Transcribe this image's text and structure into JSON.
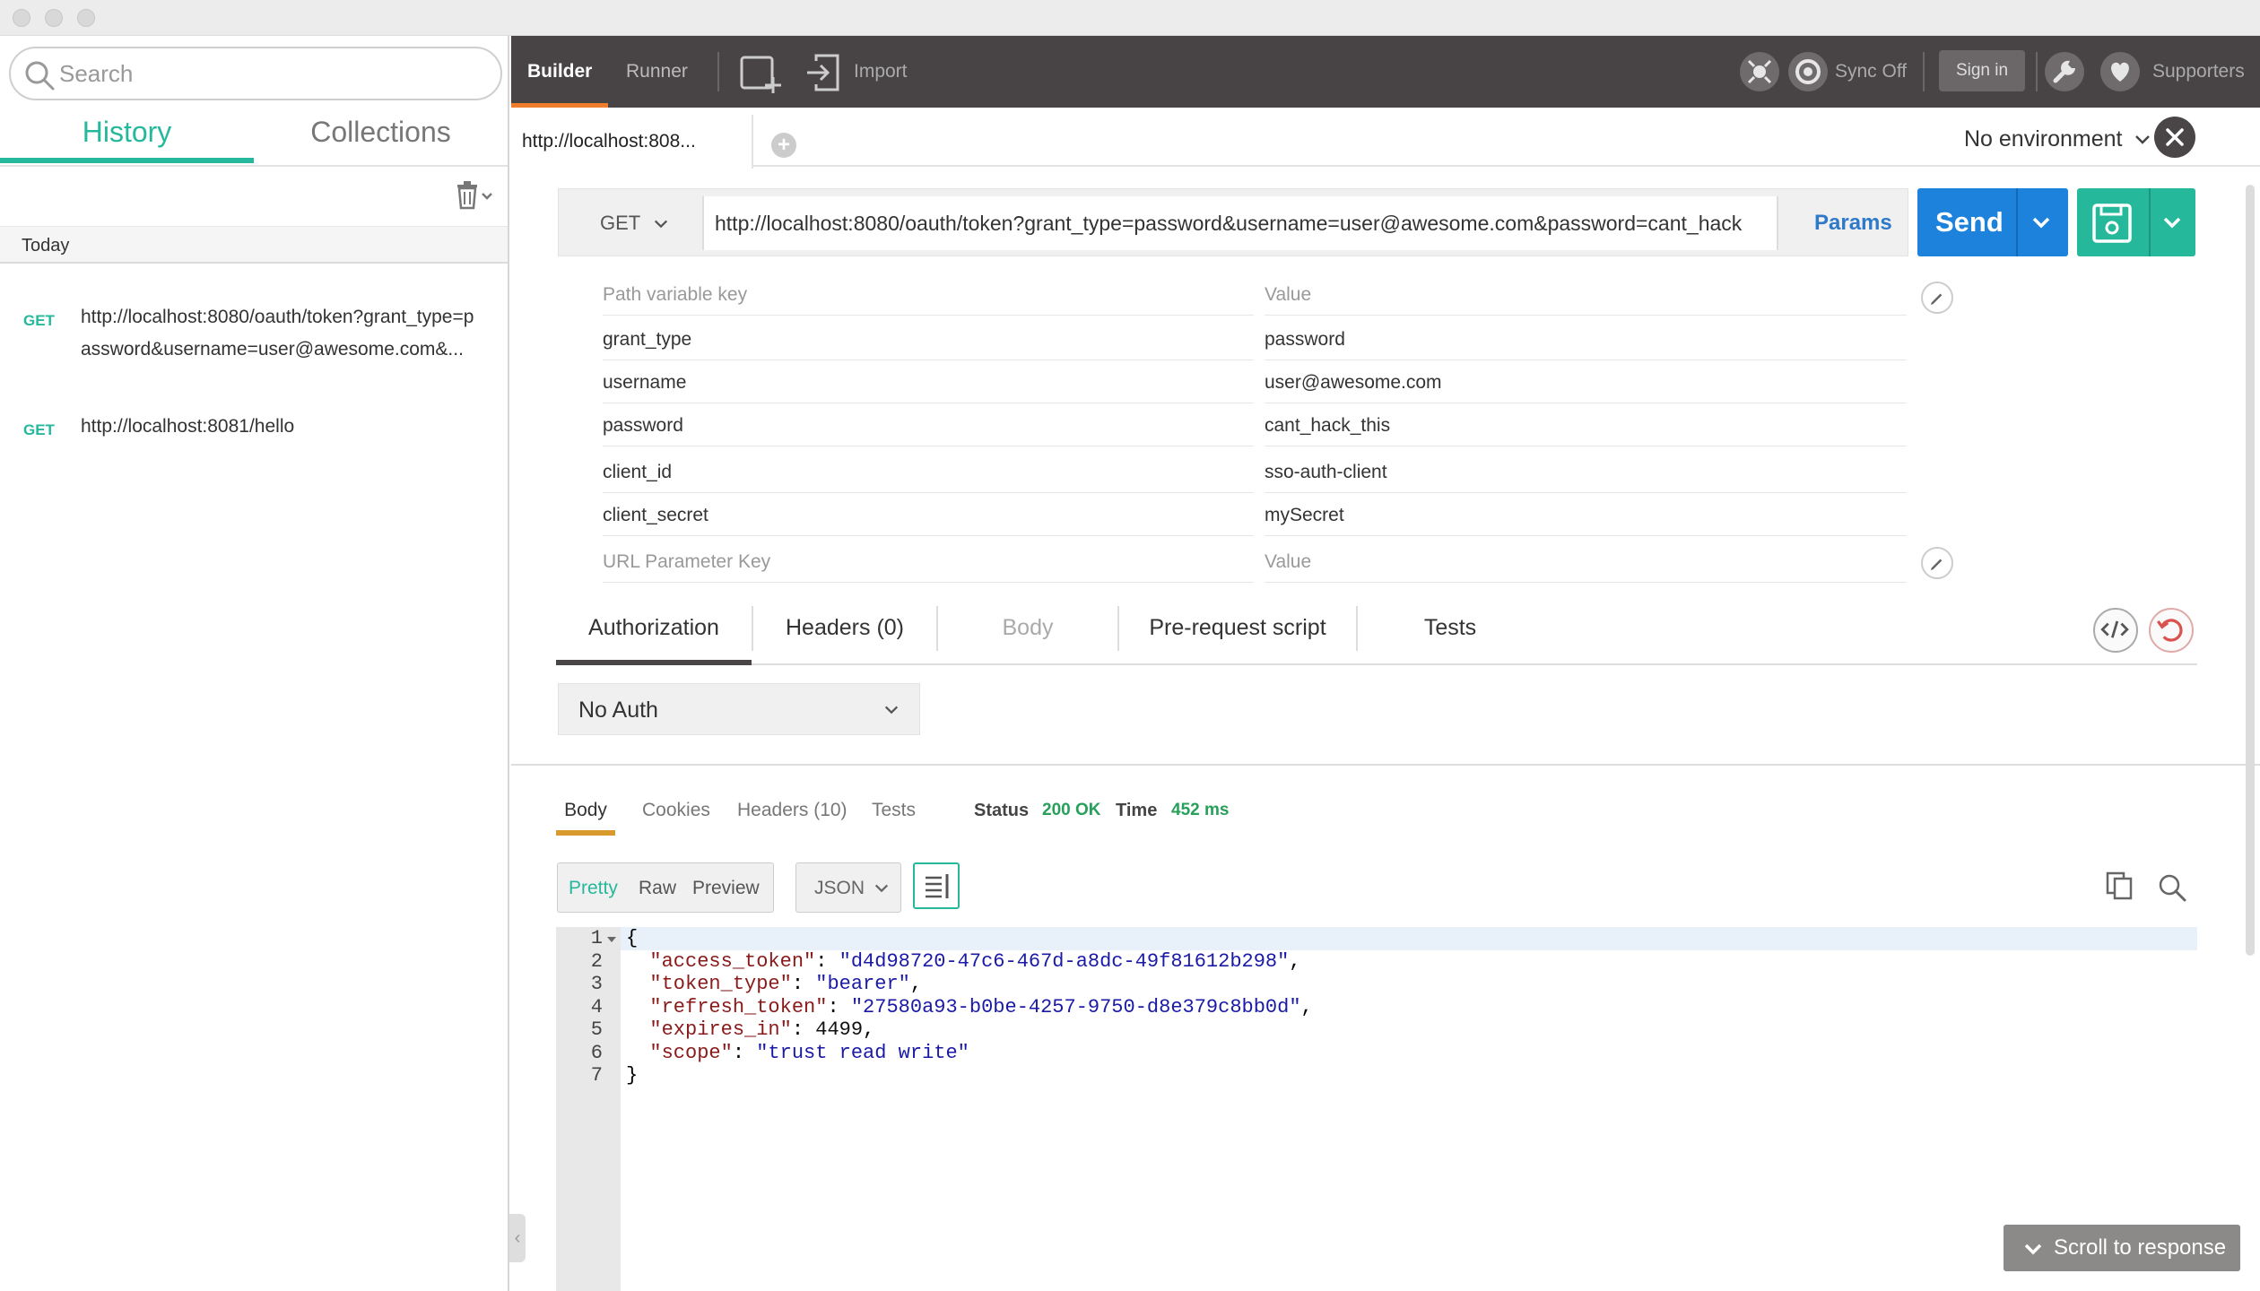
{
  "sidebar": {
    "search_placeholder": "Search",
    "tabs": [
      {
        "label": "History",
        "active": true
      },
      {
        "label": "Collections",
        "active": false
      }
    ],
    "group_label": "Today",
    "history": [
      {
        "method": "GET",
        "url": "http://localhost:8080/oauth/token?grant_type=password&username=user@awesome.com&..."
      },
      {
        "method": "GET",
        "url": "http://localhost:8081/hello"
      }
    ]
  },
  "toolbar": {
    "tab_builder": "Builder",
    "tab_runner": "Runner",
    "import_label": "Import",
    "sync_label": "Sync Off",
    "signin_label": "Sign in",
    "supporters_label": "Supporters",
    "accent_color": "#f07c2c"
  },
  "request_tab": {
    "label": "http://localhost:808...",
    "environment": "No environment"
  },
  "request": {
    "method": "GET",
    "url": "http://localhost:8080/oauth/token?grant_type=password&username=user@awesome.com&password=cant_hack",
    "params_label": "Params",
    "send_label": "Send"
  },
  "params": {
    "path_key_placeholder": "Path variable key",
    "path_value_placeholder": "Value",
    "rows": [
      {
        "key": "grant_type",
        "value": "password"
      },
      {
        "key": "username",
        "value": "user@awesome.com"
      },
      {
        "key": "password",
        "value": "cant_hack_this"
      },
      {
        "key": "client_id",
        "value": "sso-auth-client"
      },
      {
        "key": "client_secret",
        "value": "mySecret"
      }
    ],
    "url_key_placeholder": "URL Parameter Key",
    "url_value_placeholder": "Value"
  },
  "request_subtabs": {
    "authorization": "Authorization",
    "headers": "Headers (0)",
    "body": "Body",
    "prerequest": "Pre-request script",
    "tests": "Tests"
  },
  "auth": {
    "selected": "No Auth"
  },
  "response": {
    "tabs": {
      "body": "Body",
      "cookies": "Cookies",
      "headers": "Headers (10)",
      "tests": "Tests"
    },
    "status_label": "Status",
    "status_value": "200 OK",
    "time_label": "Time",
    "time_value": "452 ms",
    "views": {
      "pretty": "Pretty",
      "raw": "Raw",
      "preview": "Preview"
    },
    "format": "JSON",
    "line_numbers": [
      "1",
      "2",
      "3",
      "4",
      "5",
      "6",
      "7"
    ],
    "json": {
      "open": "{",
      "close": "}",
      "fields": [
        {
          "key": "\"access_token\"",
          "value": "\"d4d98720-47c6-467d-a8dc-49f81612b298\"",
          "sep": ","
        },
        {
          "key": "\"token_type\"",
          "value": "\"bearer\"",
          "sep": ","
        },
        {
          "key": "\"refresh_token\"",
          "value": "\"27580a93-b0be-4257-9750-d8e379c8bb0d\"",
          "sep": ","
        },
        {
          "key": "\"expires_in\"",
          "value": "4499",
          "sep": ","
        },
        {
          "key": "\"scope\"",
          "value": "\"trust read write\"",
          "sep": ""
        }
      ]
    },
    "scroll_label": "Scroll to response"
  }
}
